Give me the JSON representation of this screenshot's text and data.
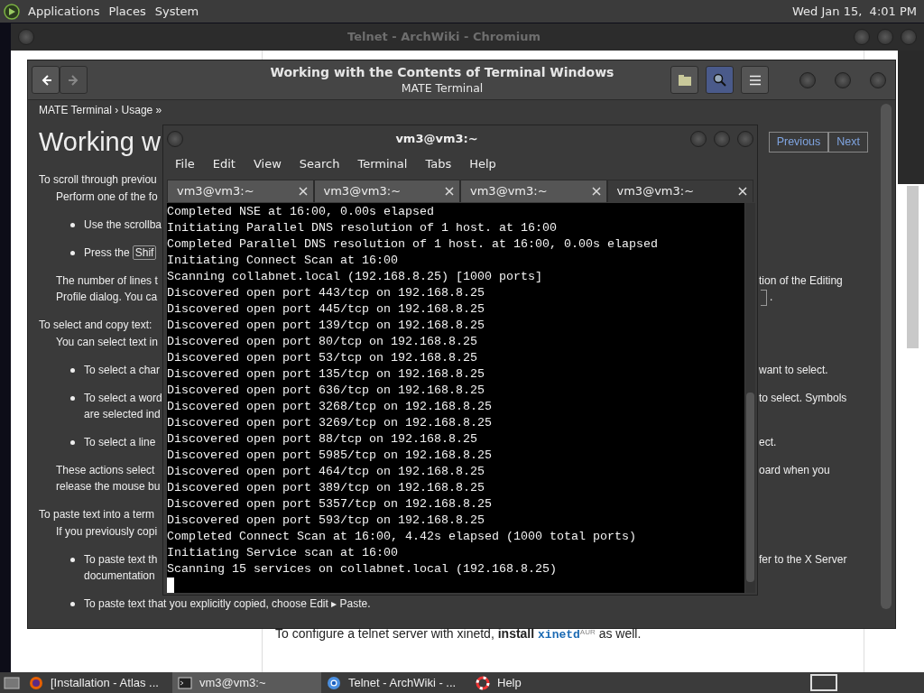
{
  "top_panel": {
    "menus": [
      "Applications",
      "Places",
      "System"
    ],
    "clock": "Wed Jan 15,  4:01 PM"
  },
  "browser": {
    "title": "Telnet - ArchWiki - Chromium",
    "page_before": "To configure a telnet server with xinetd, ",
    "page_link": "install",
    "page_code": "xinetd",
    "page_sup": "AUR",
    "page_after": " as well."
  },
  "help": {
    "title": "Working with the Contents of Terminal Windows",
    "subtitle": "MATE Terminal",
    "breadcrumb": "MATE Terminal  › Usage »",
    "heading": "Working w",
    "nav": [
      "Previous",
      "Next"
    ],
    "lines": [
      {
        "kind": "section",
        "left": "To scroll through previou"
      },
      {
        "kind": "para",
        "left": "Perform one of the fo"
      },
      {
        "kind": "bullet",
        "left": "Use the scrollba"
      },
      {
        "kind": "bullet",
        "left": "Press the",
        "key": "Shif"
      },
      {
        "kind": "para",
        "left": "The number of lines t",
        "right": "tion of the Editing"
      },
      {
        "kind": "cont",
        "left": "Profile dialog. You ca",
        "right": ".",
        "right_key": true
      },
      {
        "kind": "section",
        "left": "To select and copy text:"
      },
      {
        "kind": "para",
        "left": "You can select text in"
      },
      {
        "kind": "bullet",
        "left": "To select a char",
        "right": "want to select."
      },
      {
        "kind": "bullet",
        "left": "To select a word",
        "right": "to select. Symbols"
      },
      {
        "kind": "cont2",
        "left": "are selected ind"
      },
      {
        "kind": "bullet",
        "left": "To select a line",
        "right": "ect."
      },
      {
        "kind": "para",
        "left": "These actions select",
        "right": "oard when you"
      },
      {
        "kind": "cont",
        "left": "release the mouse bu"
      },
      {
        "kind": "section",
        "left": "To paste text into a term"
      },
      {
        "kind": "para",
        "left": "If you previously copi"
      },
      {
        "kind": "bullet",
        "left": "To paste text th",
        "right": "fer to the X Server"
      },
      {
        "kind": "cont2",
        "left": "documentation"
      },
      {
        "kind": "bullet",
        "left": "To paste text that you explicitly copied, choose Edit ▸ Paste."
      }
    ]
  },
  "terminal": {
    "title": "vm3@vm3:~",
    "menus": [
      "File",
      "Edit",
      "View",
      "Search",
      "Terminal",
      "Tabs",
      "Help"
    ],
    "tabs": [
      {
        "label": "vm3@vm3:~",
        "selected": false
      },
      {
        "label": "vm3@vm3:~",
        "selected": false
      },
      {
        "label": "vm3@vm3:~",
        "selected": false
      },
      {
        "label": "vm3@vm3:~",
        "selected": true
      }
    ],
    "lines": [
      "Completed NSE at 16:00, 0.00s elapsed",
      "Initiating Parallel DNS resolution of 1 host. at 16:00",
      "Completed Parallel DNS resolution of 1 host. at 16:00, 0.00s elapsed",
      "Initiating Connect Scan at 16:00",
      "Scanning collabnet.local (192.168.8.25) [1000 ports]",
      "Discovered open port 443/tcp on 192.168.8.25",
      "Discovered open port 445/tcp on 192.168.8.25",
      "Discovered open port 139/tcp on 192.168.8.25",
      "Discovered open port 80/tcp on 192.168.8.25",
      "Discovered open port 53/tcp on 192.168.8.25",
      "Discovered open port 135/tcp on 192.168.8.25",
      "Discovered open port 636/tcp on 192.168.8.25",
      "Discovered open port 3268/tcp on 192.168.8.25",
      "Discovered open port 3269/tcp on 192.168.8.25",
      "Discovered open port 88/tcp on 192.168.8.25",
      "Discovered open port 5985/tcp on 192.168.8.25",
      "Discovered open port 464/tcp on 192.168.8.25",
      "Discovered open port 389/tcp on 192.168.8.25",
      "Discovered open port 5357/tcp on 192.168.8.25",
      "Discovered open port 593/tcp on 192.168.8.25",
      "Completed Connect Scan at 16:00, 4.42s elapsed (1000 total ports)",
      "Initiating Service scan at 16:00",
      "Scanning 15 services on collabnet.local (192.168.8.25)"
    ]
  },
  "taskbar": [
    {
      "kind": "firefox",
      "label": "[Installation - Atlas ...",
      "selected": false
    },
    {
      "kind": "terminal",
      "label": "vm3@vm3:~",
      "selected": true
    },
    {
      "kind": "chromium",
      "label": "Telnet - ArchWiki - ...",
      "selected": false
    },
    {
      "kind": "help",
      "label": "Help",
      "selected": false
    }
  ]
}
